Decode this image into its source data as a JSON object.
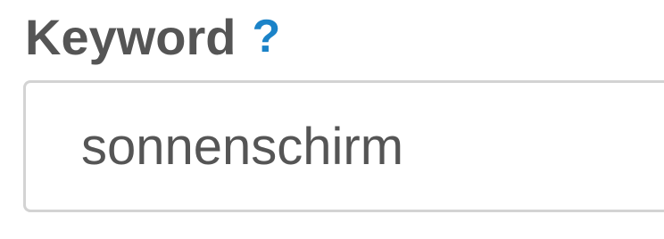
{
  "field": {
    "label": "Keyword",
    "help_glyph": "?",
    "help_icon": "question-mark-icon",
    "value": "sonnenschirm"
  },
  "colors": {
    "label": "#555555",
    "help": "#1b83c8",
    "border": "#d3d3d3"
  }
}
